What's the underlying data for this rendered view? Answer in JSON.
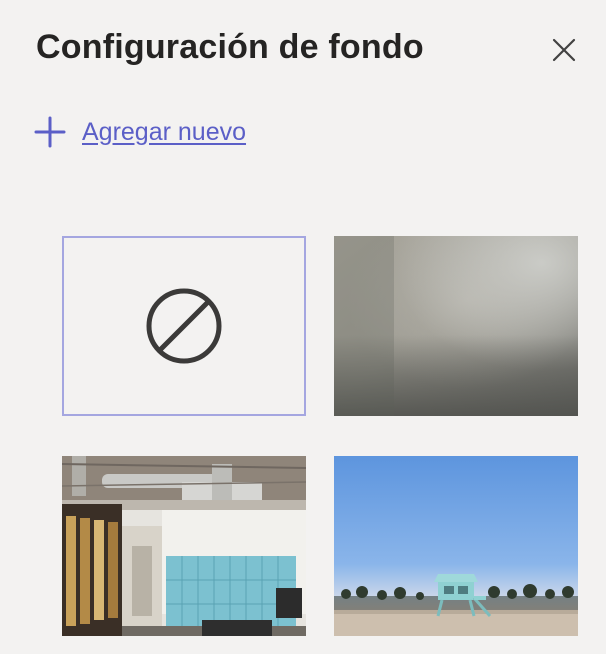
{
  "header": {
    "title": "Configuración de fondo",
    "close_icon": "close-icon"
  },
  "add_new": {
    "icon": "plus-icon",
    "label": "Agregar nuevo"
  },
  "backgrounds": [
    {
      "id": "none",
      "icon": "no-background-icon",
      "selected": true
    },
    {
      "id": "blur",
      "selected": false
    },
    {
      "id": "office",
      "selected": false
    },
    {
      "id": "beach",
      "selected": false
    }
  ],
  "colors": {
    "accent": "#5b5fc7",
    "selected_border": "#a4a6e0",
    "panel_bg": "#f3f2f1",
    "title_text": "#252423"
  }
}
